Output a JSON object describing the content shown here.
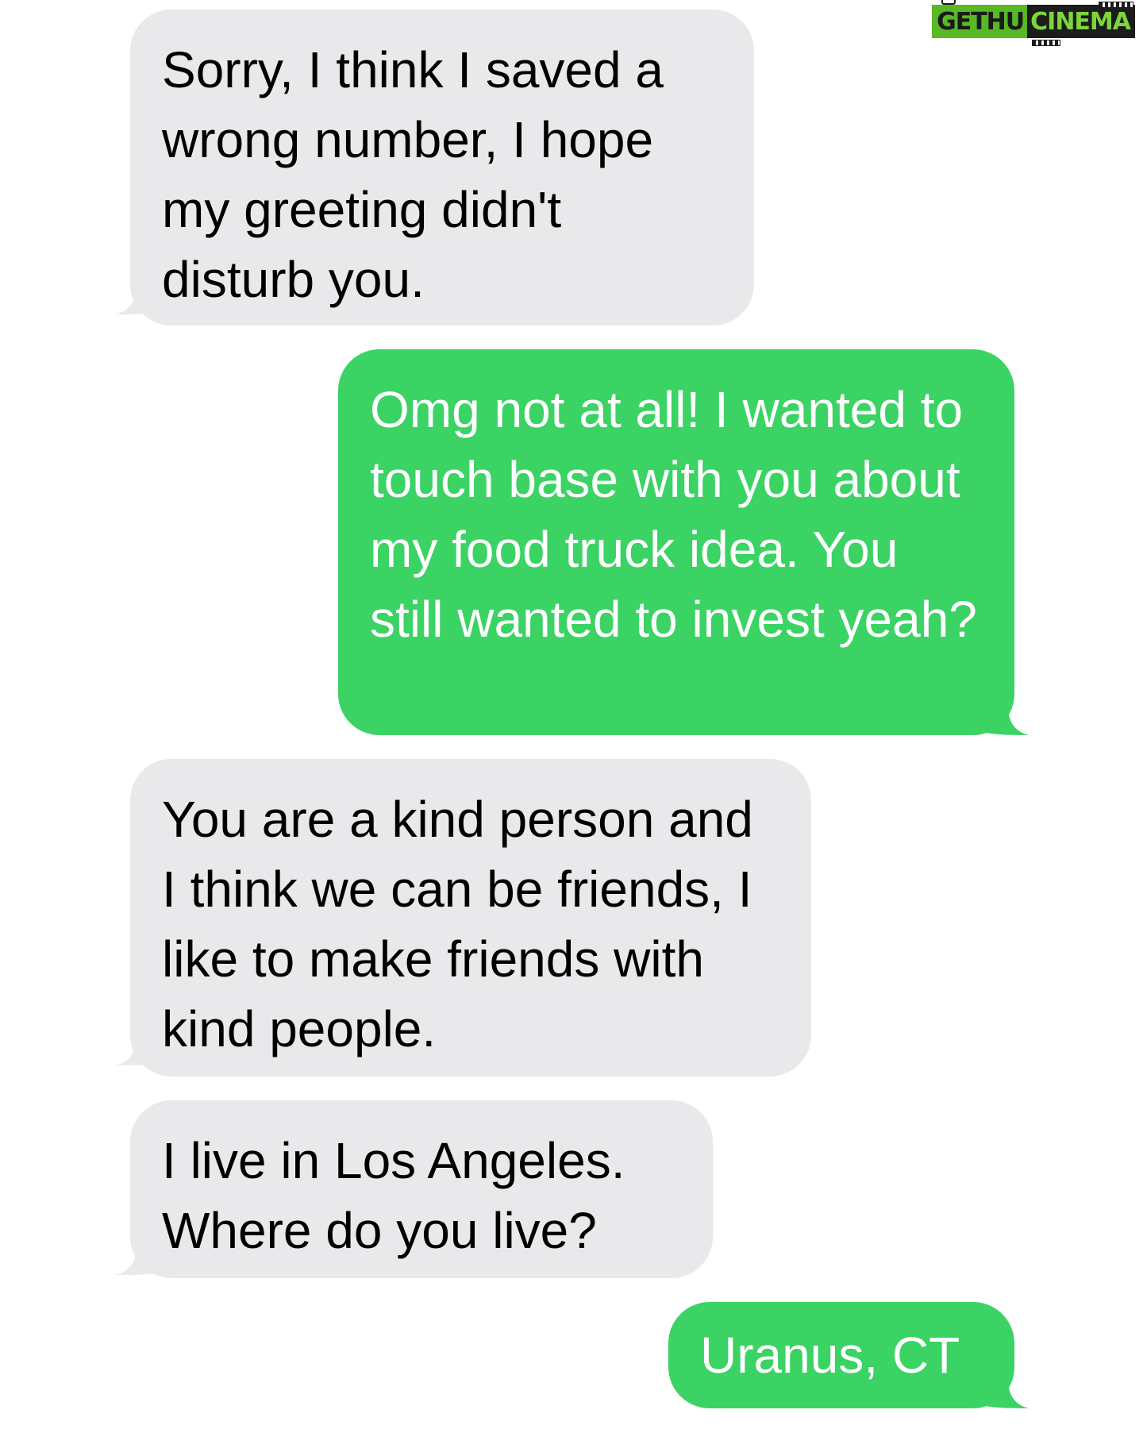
{
  "watermark": {
    "part1": "GETHU",
    "part2": "CINEMA"
  },
  "colors": {
    "received_bubble": "#e9e9eb",
    "sent_bubble": "#3ad364",
    "received_text": "#000000",
    "sent_text": "#ffffff"
  },
  "messages": [
    {
      "direction": "received",
      "text": "Sorry, I think I saved a wrong number, I hope my greeting didn't disturb you."
    },
    {
      "direction": "sent",
      "text": "Omg not at all! I wanted to touch base with you about my food truck idea. You still wanted to invest yeah?"
    },
    {
      "direction": "received",
      "text": "You are a kind person and I think we can be friends, I like to make friends with kind people."
    },
    {
      "direction": "received",
      "text": "I live in Los Angeles. Where do you live?"
    },
    {
      "direction": "sent",
      "text": "Uranus, CT"
    }
  ]
}
